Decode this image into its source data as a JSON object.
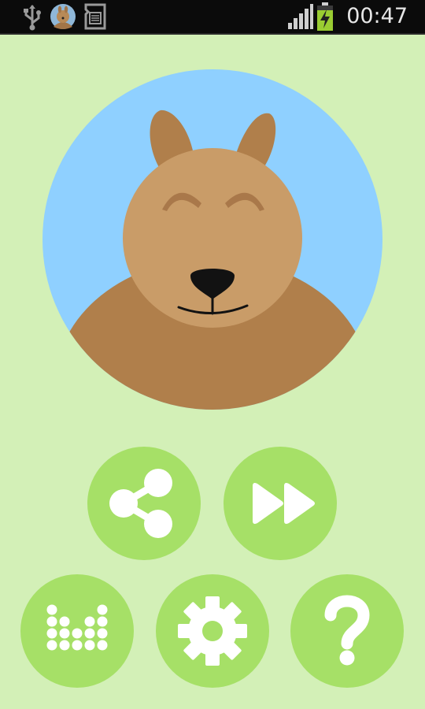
{
  "status_bar": {
    "time": "00:47",
    "icons": [
      "usb-icon",
      "app-notification-icon",
      "sd-card-icon",
      "signal-icon",
      "battery-charging-icon"
    ]
  },
  "main": {
    "mascot": "kangaroo-face-illustration",
    "buttons": [
      {
        "name": "share-button",
        "icon": "share-icon"
      },
      {
        "name": "skip-button",
        "icon": "fast-forward-icon"
      },
      {
        "name": "soundboard-button",
        "icon": "dot-grid-icon"
      },
      {
        "name": "settings-button",
        "icon": "gear-icon"
      },
      {
        "name": "help-button",
        "icon": "question-mark-icon"
      }
    ]
  },
  "colors": {
    "background": "#d3f0b7",
    "button": "#a6e067",
    "sky": "#8fd0ff",
    "kangaroo_face": "#c99c68",
    "kangaroo_dark": "#b07f4b"
  }
}
